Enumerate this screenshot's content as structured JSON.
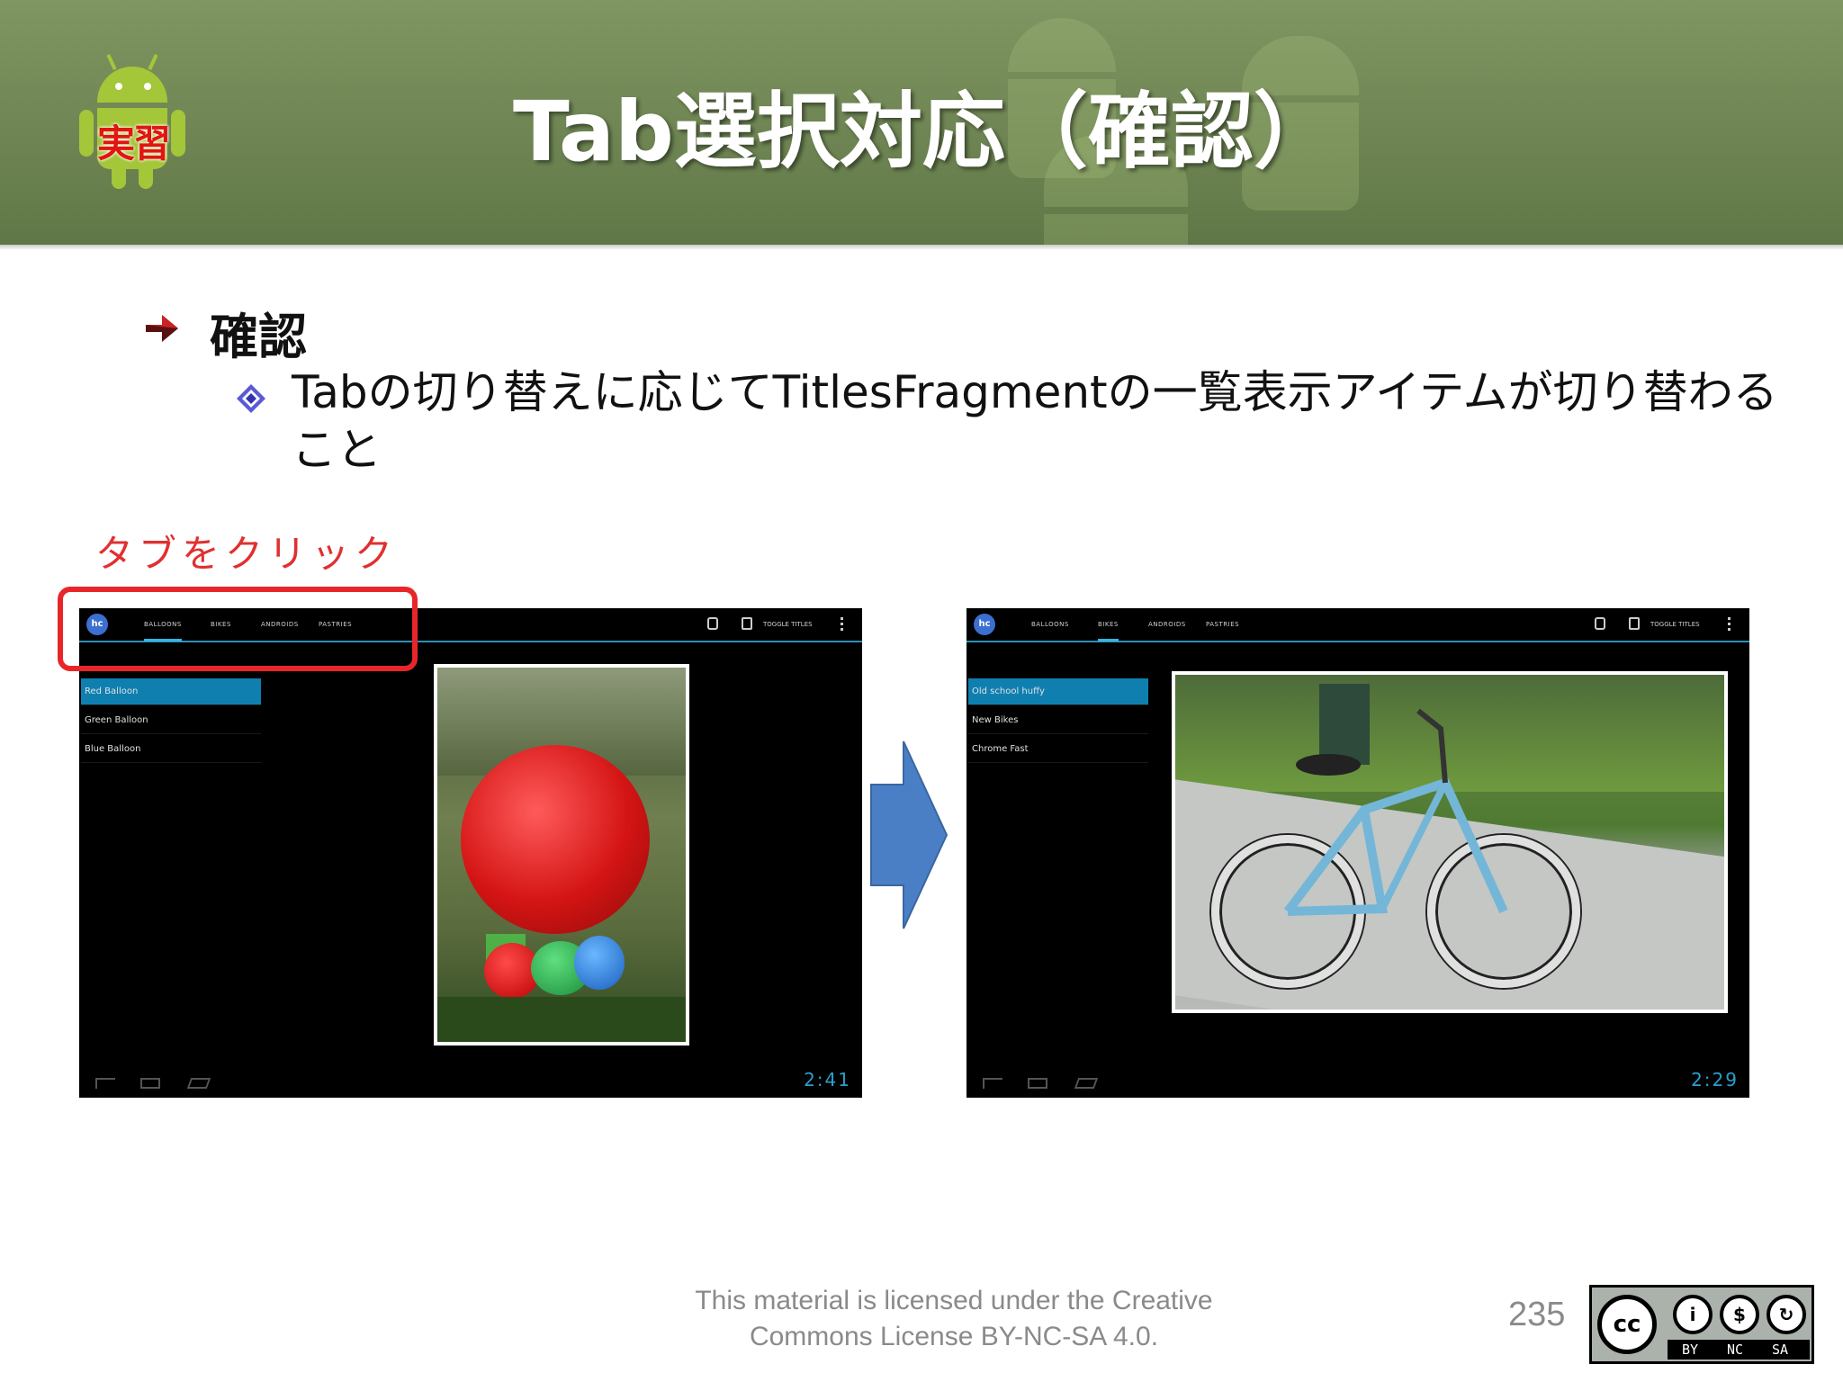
{
  "slide": {
    "title": "Tab選択対応（確認）",
    "badge_text": "実習",
    "bullet1": "確認",
    "bullet2": "Tabの切り替えに応じてTitlesFragmentの一覧表示アイテムが切り替わること",
    "annotation": "タブをクリック",
    "license": "This material is licensed under the Creative Commons License BY-NC-SA 4.0.",
    "page_number": "235"
  },
  "colors": {
    "header": "#6d8452",
    "annotation": "#e03030",
    "highlight": "#e8262a",
    "arrow": "#4a7fc6",
    "tab_indicator": "#33b5e5"
  },
  "screens": [
    {
      "app_icon": "hc",
      "tabs": [
        "BALLOONS",
        "BIKES",
        "ANDROIDS",
        "PASTRIES"
      ],
      "selected_tab": 0,
      "toggle_label": "TOGGLE TITLES",
      "items": [
        "Red Balloon",
        "Green Balloon",
        "Blue Balloon"
      ],
      "selected_item": 0,
      "clock": "2:41"
    },
    {
      "app_icon": "hc",
      "tabs": [
        "BALLOONS",
        "BIKES",
        "ANDROIDS",
        "PASTRIES"
      ],
      "selected_tab": 1,
      "toggle_label": "TOGGLE TITLES",
      "items": [
        "Old school huffy",
        "New Bikes",
        "Chrome Fast"
      ],
      "selected_item": 0,
      "clock": "2:29"
    }
  ],
  "cc_badge": {
    "cc": "cc",
    "labels": [
      "BY",
      "NC",
      "SA"
    ]
  }
}
